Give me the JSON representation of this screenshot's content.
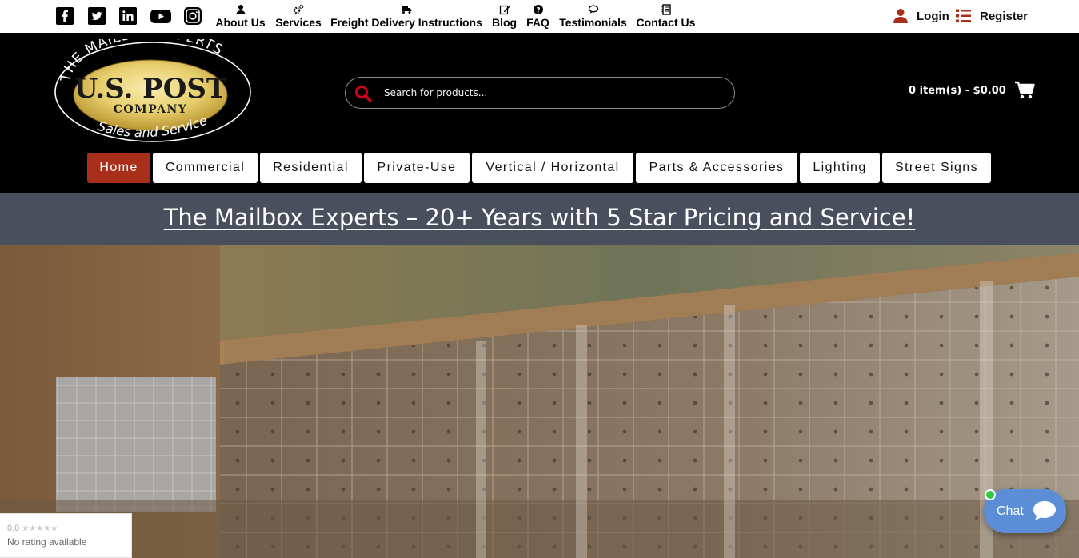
{
  "social": {
    "items": [
      {
        "name": "facebook-icon"
      },
      {
        "name": "twitter-icon"
      },
      {
        "name": "linkedin-icon"
      },
      {
        "name": "youtube-icon"
      },
      {
        "name": "instagram-icon"
      }
    ]
  },
  "topnav": {
    "items": [
      {
        "label": "About Us",
        "icon": "user-icon"
      },
      {
        "label": "Services",
        "icon": "gears-icon"
      },
      {
        "label": "Freight Delivery Instructions",
        "icon": "truck-icon"
      },
      {
        "label": "Blog",
        "icon": "edit-icon"
      },
      {
        "label": "FAQ",
        "icon": "question-icon"
      },
      {
        "label": "Testimonials",
        "icon": "comments-icon"
      },
      {
        "label": "Contact Us",
        "icon": "address-book-icon"
      }
    ]
  },
  "account": {
    "login_label": "Login",
    "register_label": "Register"
  },
  "logo": {
    "arc_top": "THE MAILBOX EXPERTS",
    "main": "U.S. POST",
    "sub": "COMPANY",
    "arc_bottom": "Sales and Service"
  },
  "search": {
    "placeholder": "Search for products..."
  },
  "cart": {
    "summary": "0 item(s) - $0.00"
  },
  "mainnav": {
    "items": [
      {
        "label": "Home",
        "active": true
      },
      {
        "label": "Commercial",
        "active": false
      },
      {
        "label": "Residential",
        "active": false
      },
      {
        "label": "Private-Use",
        "active": false
      },
      {
        "label": "Vertical / Horizontal",
        "active": false
      },
      {
        "label": "Parts & Accessories",
        "active": false
      },
      {
        "label": "Lighting",
        "active": false
      },
      {
        "label": "Street Signs",
        "active": false
      }
    ]
  },
  "banner": {
    "headline": "The Mailbox Experts – 20+ Years with 5 Star Pricing and Service!"
  },
  "rating": {
    "score": "0.0",
    "stars": "★★★★★",
    "text": "No rating available"
  },
  "chat": {
    "label": "Chat"
  },
  "colors": {
    "accent_red": "#a8301a",
    "search_icon_red": "#d0021b",
    "banner_bg": "#4a4f5e",
    "chat_blue": "#5b8ed6",
    "online_green": "#2ecc40"
  }
}
